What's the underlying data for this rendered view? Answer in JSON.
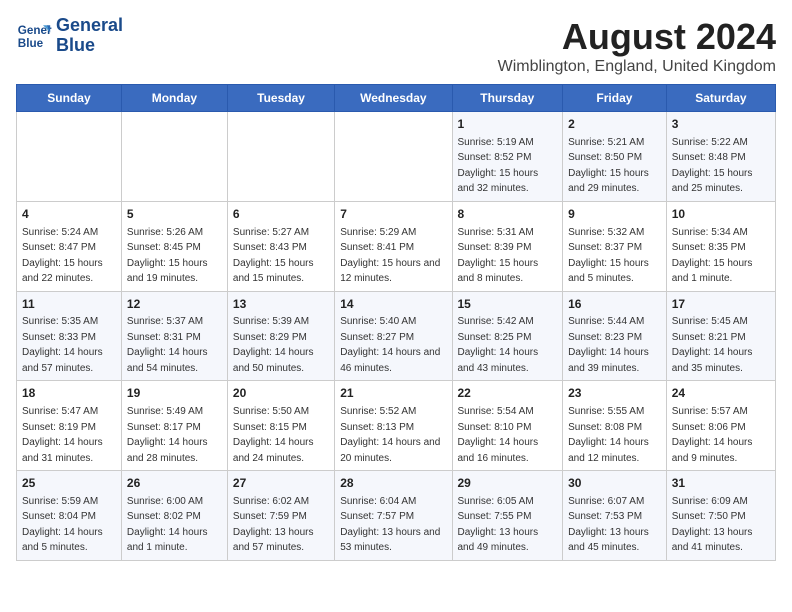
{
  "header": {
    "logo_line1": "General",
    "logo_line2": "Blue",
    "main_title": "August 2024",
    "subtitle": "Wimblington, England, United Kingdom"
  },
  "days_of_week": [
    "Sunday",
    "Monday",
    "Tuesday",
    "Wednesday",
    "Thursday",
    "Friday",
    "Saturday"
  ],
  "weeks": [
    {
      "cells": [
        {
          "empty": true
        },
        {
          "empty": true
        },
        {
          "empty": true
        },
        {
          "empty": true
        },
        {
          "day": "1",
          "sunrise": "5:19 AM",
          "sunset": "8:52 PM",
          "daylight": "15 hours and 32 minutes."
        },
        {
          "day": "2",
          "sunrise": "5:21 AM",
          "sunset": "8:50 PM",
          "daylight": "15 hours and 29 minutes."
        },
        {
          "day": "3",
          "sunrise": "5:22 AM",
          "sunset": "8:48 PM",
          "daylight": "15 hours and 25 minutes."
        }
      ]
    },
    {
      "cells": [
        {
          "day": "4",
          "sunrise": "5:24 AM",
          "sunset": "8:47 PM",
          "daylight": "15 hours and 22 minutes."
        },
        {
          "day": "5",
          "sunrise": "5:26 AM",
          "sunset": "8:45 PM",
          "daylight": "15 hours and 19 minutes."
        },
        {
          "day": "6",
          "sunrise": "5:27 AM",
          "sunset": "8:43 PM",
          "daylight": "15 hours and 15 minutes."
        },
        {
          "day": "7",
          "sunrise": "5:29 AM",
          "sunset": "8:41 PM",
          "daylight": "15 hours and 12 minutes."
        },
        {
          "day": "8",
          "sunrise": "5:31 AM",
          "sunset": "8:39 PM",
          "daylight": "15 hours and 8 minutes."
        },
        {
          "day": "9",
          "sunrise": "5:32 AM",
          "sunset": "8:37 PM",
          "daylight": "15 hours and 5 minutes."
        },
        {
          "day": "10",
          "sunrise": "5:34 AM",
          "sunset": "8:35 PM",
          "daylight": "15 hours and 1 minute."
        }
      ]
    },
    {
      "cells": [
        {
          "day": "11",
          "sunrise": "5:35 AM",
          "sunset": "8:33 PM",
          "daylight": "14 hours and 57 minutes."
        },
        {
          "day": "12",
          "sunrise": "5:37 AM",
          "sunset": "8:31 PM",
          "daylight": "14 hours and 54 minutes."
        },
        {
          "day": "13",
          "sunrise": "5:39 AM",
          "sunset": "8:29 PM",
          "daylight": "14 hours and 50 minutes."
        },
        {
          "day": "14",
          "sunrise": "5:40 AM",
          "sunset": "8:27 PM",
          "daylight": "14 hours and 46 minutes."
        },
        {
          "day": "15",
          "sunrise": "5:42 AM",
          "sunset": "8:25 PM",
          "daylight": "14 hours and 43 minutes."
        },
        {
          "day": "16",
          "sunrise": "5:44 AM",
          "sunset": "8:23 PM",
          "daylight": "14 hours and 39 minutes."
        },
        {
          "day": "17",
          "sunrise": "5:45 AM",
          "sunset": "8:21 PM",
          "daylight": "14 hours and 35 minutes."
        }
      ]
    },
    {
      "cells": [
        {
          "day": "18",
          "sunrise": "5:47 AM",
          "sunset": "8:19 PM",
          "daylight": "14 hours and 31 minutes."
        },
        {
          "day": "19",
          "sunrise": "5:49 AM",
          "sunset": "8:17 PM",
          "daylight": "14 hours and 28 minutes."
        },
        {
          "day": "20",
          "sunrise": "5:50 AM",
          "sunset": "8:15 PM",
          "daylight": "14 hours and 24 minutes."
        },
        {
          "day": "21",
          "sunrise": "5:52 AM",
          "sunset": "8:13 PM",
          "daylight": "14 hours and 20 minutes."
        },
        {
          "day": "22",
          "sunrise": "5:54 AM",
          "sunset": "8:10 PM",
          "daylight": "14 hours and 16 minutes."
        },
        {
          "day": "23",
          "sunrise": "5:55 AM",
          "sunset": "8:08 PM",
          "daylight": "14 hours and 12 minutes."
        },
        {
          "day": "24",
          "sunrise": "5:57 AM",
          "sunset": "8:06 PM",
          "daylight": "14 hours and 9 minutes."
        }
      ]
    },
    {
      "cells": [
        {
          "day": "25",
          "sunrise": "5:59 AM",
          "sunset": "8:04 PM",
          "daylight": "14 hours and 5 minutes."
        },
        {
          "day": "26",
          "sunrise": "6:00 AM",
          "sunset": "8:02 PM",
          "daylight": "14 hours and 1 minute."
        },
        {
          "day": "27",
          "sunrise": "6:02 AM",
          "sunset": "7:59 PM",
          "daylight": "13 hours and 57 minutes."
        },
        {
          "day": "28",
          "sunrise": "6:04 AM",
          "sunset": "7:57 PM",
          "daylight": "13 hours and 53 minutes."
        },
        {
          "day": "29",
          "sunrise": "6:05 AM",
          "sunset": "7:55 PM",
          "daylight": "13 hours and 49 minutes."
        },
        {
          "day": "30",
          "sunrise": "6:07 AM",
          "sunset": "7:53 PM",
          "daylight": "13 hours and 45 minutes."
        },
        {
          "day": "31",
          "sunrise": "6:09 AM",
          "sunset": "7:50 PM",
          "daylight": "13 hours and 41 minutes."
        }
      ]
    }
  ],
  "labels": {
    "sunrise_label": "Sunrise:",
    "sunset_label": "Sunset:",
    "daylight_label": "Daylight:"
  }
}
